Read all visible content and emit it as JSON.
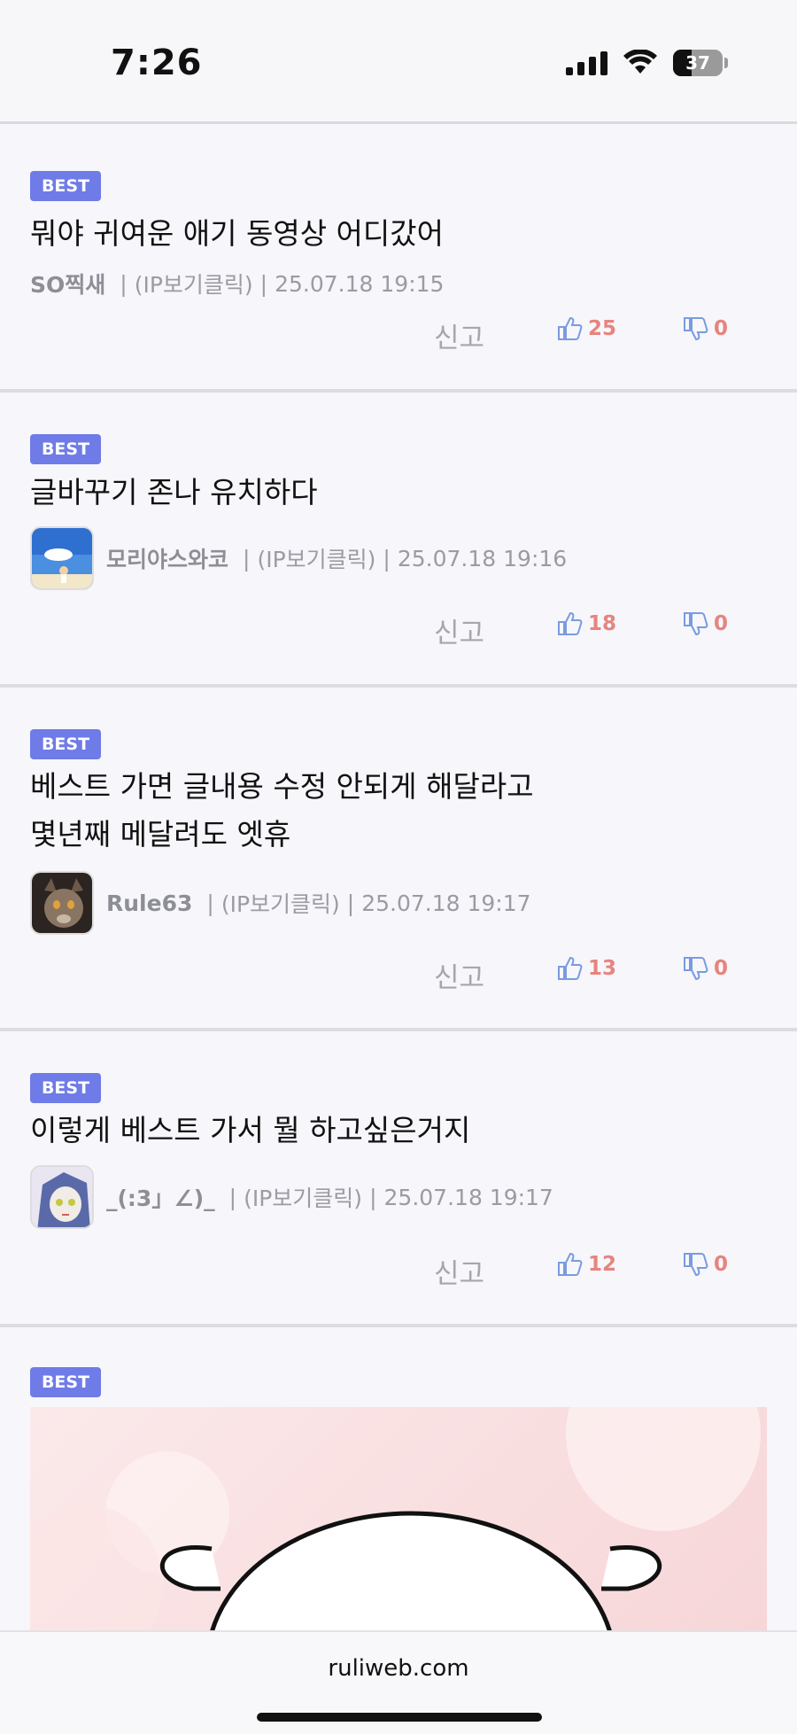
{
  "status_bar": {
    "time": "7:26",
    "battery": "37",
    "battery_level": 0.37
  },
  "comments": [
    {
      "badge": "BEST",
      "lines": [
        "뭐야 귀여운 애기 동영상 어디갔어"
      ],
      "author": "SO찍새",
      "ip": "(IP보기클릭)",
      "date": "25.07.18 19:15",
      "report": "신고",
      "likes": "25",
      "dislikes": "0"
    },
    {
      "badge": "BEST",
      "lines": [
        "글바꾸기 존나 유치하다"
      ],
      "author": "모리야스와코",
      "ip": "(IP보기클릭)",
      "date": "25.07.18 19:16",
      "report": "신고",
      "likes": "18",
      "dislikes": "0"
    },
    {
      "badge": "BEST",
      "lines": [
        "베스트 가면 글내용 수정 안되게 해달라고",
        "몇년째 메달려도 엣휴"
      ],
      "author": "Rule63",
      "ip": "(IP보기클릭)",
      "date": "25.07.18 19:17",
      "report": "신고",
      "likes": "13",
      "dislikes": "0"
    },
    {
      "badge": "BEST",
      "lines": [
        "이렇게 베스트 가서 뭘 하고싶은거지"
      ],
      "author": "_(:3」∠)_",
      "ip": "(IP보기클릭)",
      "date": "25.07.18 19:17",
      "report": "신고",
      "likes": "12",
      "dislikes": "0"
    },
    {
      "badge": "BEST"
    }
  ],
  "bottom_bar": {
    "url": "ruliweb.com"
  },
  "colors": {
    "badge": "#6f7be6",
    "vote_count": "#e6847e",
    "thumb_icon": "#7a9be0"
  }
}
